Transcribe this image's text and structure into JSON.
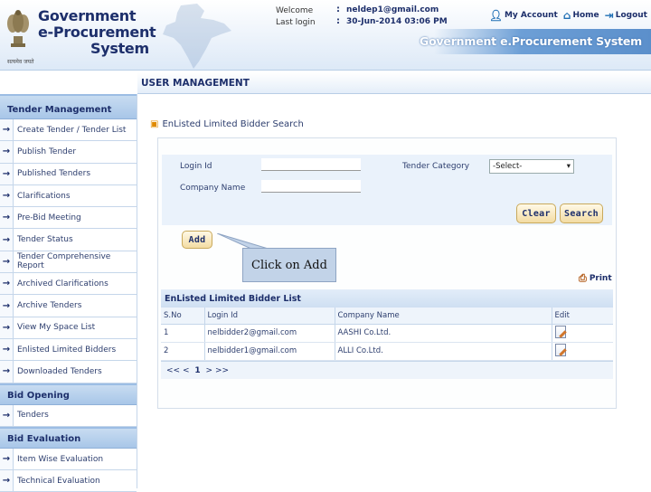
{
  "header": {
    "logo_lines": [
      "Government",
      "e-Procurement",
      "System"
    ],
    "emblem_caption": "सत्यमेव जयते",
    "welcome_label": "Welcome",
    "welcome_value": "neldep1@gmail.com",
    "last_login_label": "Last login",
    "last_login_value": "30-Jun-2014 03:06 PM",
    "colon": ":",
    "links": {
      "my_account": "My Account",
      "home": "Home",
      "logout": "Logout"
    },
    "brand_right": "Government e.Procurement System"
  },
  "section_title": "USER MANAGEMENT",
  "sidebar": {
    "groups": [
      {
        "title": "Tender Management",
        "items": [
          "Create Tender / Tender List",
          "Publish Tender",
          "Published Tenders",
          "Clarifications",
          "Pre-Bid Meeting",
          "Tender Status",
          "Tender Comprehensive Report",
          "Archived Clarifications",
          "Archive Tenders",
          "View My Space List",
          "Enlisted Limited Bidders",
          "Downloaded Tenders"
        ]
      },
      {
        "title": "Bid Opening",
        "items": [
          "Tenders"
        ]
      },
      {
        "title": "Bid Evaluation",
        "items": [
          "Item Wise Evaluation",
          "Technical Evaluation"
        ]
      }
    ]
  },
  "main": {
    "breadcrumb": "EnListed Limited Bidder Search",
    "form": {
      "login_id_label": "Login Id",
      "login_id_value": "",
      "company_name_label": "Company Name",
      "company_name_value": "",
      "tender_category_label": "Tender Category",
      "tender_category_value": "-Select-"
    },
    "buttons": {
      "clear": "Clear",
      "search": "Search",
      "add": "Add"
    },
    "callout": "Click on Add",
    "print_label": "Print",
    "list": {
      "title": "EnListed Limited Bidder List",
      "columns": [
        "S.No",
        "Login Id",
        "Company Name",
        "Edit"
      ],
      "rows": [
        {
          "sno": "1",
          "login": "nelbidder2@gmail.com",
          "company": "AASHI Co.Ltd."
        },
        {
          "sno": "2",
          "login": "nelbidder1@gmail.com",
          "company": "ALLI Co.Ltd."
        }
      ],
      "pager": {
        "prev": "<<",
        "page": "1",
        "next": ">>",
        "lt": "<",
        "gt": ">"
      }
    }
  },
  "colors": {
    "brand_navy": "#1d2f6b",
    "header_blue": "#5b8fcb",
    "button_gold": "#f3dca3"
  }
}
